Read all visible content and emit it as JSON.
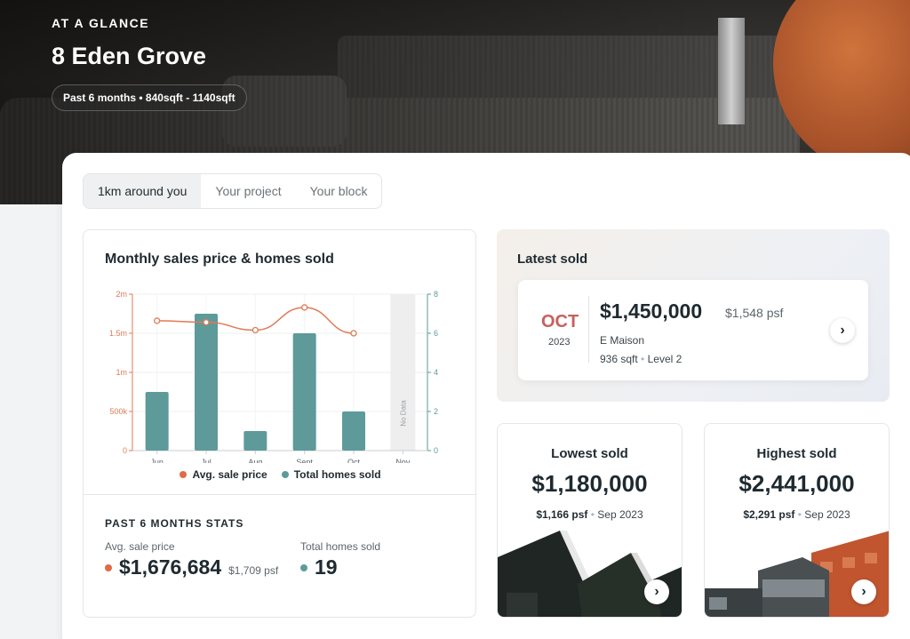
{
  "hero": {
    "eyebrow": "AT A GLANCE",
    "address": "8 Eden Grove",
    "filter": "Past 6 months • 840sqft - 1140sqft"
  },
  "tabs": [
    {
      "label": "1km around you",
      "active": true
    },
    {
      "label": "Your project",
      "active": false
    },
    {
      "label": "Your block",
      "active": false
    }
  ],
  "chart": {
    "title": "Monthly sales price & homes sold",
    "legend": {
      "price": "Avg. sale price",
      "homes": "Total homes sold"
    },
    "no_data_label": "No Data",
    "colors": {
      "bar": "#5e9a9a",
      "line": "#e07a55",
      "price_dot": "#e06b45",
      "homes_dot": "#5e9a9a"
    }
  },
  "chart_data": {
    "type": "bar",
    "categories": [
      "Jun",
      "Jul",
      "Aug",
      "Sept",
      "Oct",
      "Nov"
    ],
    "series": [
      {
        "name": "Total homes sold",
        "type": "bar",
        "axis": "right",
        "values": [
          3,
          7,
          1,
          6,
          2,
          null
        ]
      },
      {
        "name": "Avg. sale price",
        "type": "line",
        "axis": "left",
        "values": [
          1660000,
          1640000,
          1540000,
          1830000,
          1500000,
          null
        ]
      }
    ],
    "y_left": {
      "ticks": [
        "0",
        "500k",
        "1m",
        "1.5m",
        "2m"
      ],
      "range": [
        0,
        2000000
      ]
    },
    "y_right": {
      "ticks": [
        "0",
        "2",
        "4",
        "6",
        "8"
      ],
      "range": [
        0,
        8
      ]
    },
    "no_data_category": "Nov"
  },
  "stats": {
    "heading": "PAST 6 MONTHS STATS",
    "avg_label": "Avg. sale price",
    "avg_value": "$1,676,684",
    "avg_psf": "$1,709 psf",
    "homes_label": "Total homes sold",
    "homes_value": "19"
  },
  "latest": {
    "title": "Latest sold",
    "month": "OCT",
    "year": "2023",
    "price": "$1,450,000",
    "psf": "$1,548 psf",
    "project": "E Maison",
    "unit_sqft": "936 sqft",
    "unit_level": "Level 2"
  },
  "lowest": {
    "title": "Lowest sold",
    "price": "$1,180,000",
    "psf": "$1,166 psf",
    "date": "Sep 2023"
  },
  "highest": {
    "title": "Highest sold",
    "price": "$2,441,000",
    "psf": "$2,291 psf",
    "date": "Sep 2023"
  }
}
